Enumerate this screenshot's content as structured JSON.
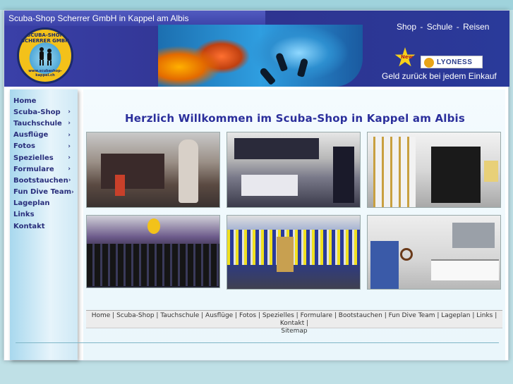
{
  "header": {
    "site_title": "Scuba-Shop Scherrer GmbH in Kappel am Albis",
    "top_nav": [
      "Shop",
      "-",
      "Schule",
      "-",
      "Reisen"
    ],
    "logo_text": "SCUBA-SHOP SCHERRER GMBH",
    "logo_url": "www.scubashop-kappel.ch",
    "new_badge": "New",
    "partner": "LYONESS",
    "cashback_text": "Geld zurück bei jedem Einkauf"
  },
  "sidebar": {
    "items": [
      {
        "label": "Home",
        "has_sub": false
      },
      {
        "label": "Scuba-Shop",
        "has_sub": true
      },
      {
        "label": "Tauchschule",
        "has_sub": true
      },
      {
        "label": "Ausflüge",
        "has_sub": true
      },
      {
        "label": "Fotos",
        "has_sub": true
      },
      {
        "label": "Spezielles",
        "has_sub": true
      },
      {
        "label": "Formulare",
        "has_sub": true
      },
      {
        "label": "Bootstauchen",
        "has_sub": true
      },
      {
        "label": "Fun Dive Team",
        "has_sub": true
      },
      {
        "label": "Lageplan",
        "has_sub": false
      },
      {
        "label": "Links",
        "has_sub": false
      },
      {
        "label": "Kontakt",
        "has_sub": false
      }
    ]
  },
  "main": {
    "welcome": "Herzlich Willkommen im Scuba-Shop in Kappel am Albis"
  },
  "footer": {
    "links": [
      "Home",
      "Scuba-Shop",
      "Tauchschule",
      "Ausflüge",
      "Fotos",
      "Spezielles",
      "Formulare",
      "Bootstauchen",
      "Fun Dive Team",
      "Lageplan",
      "Links",
      "Kontakt",
      "Sitemap"
    ]
  },
  "colors": {
    "header_bg": "#2f338f",
    "menu_text": "#2a2f7c",
    "welcome_text": "#2b2f9c",
    "page_bg": "#bfe0e6"
  }
}
